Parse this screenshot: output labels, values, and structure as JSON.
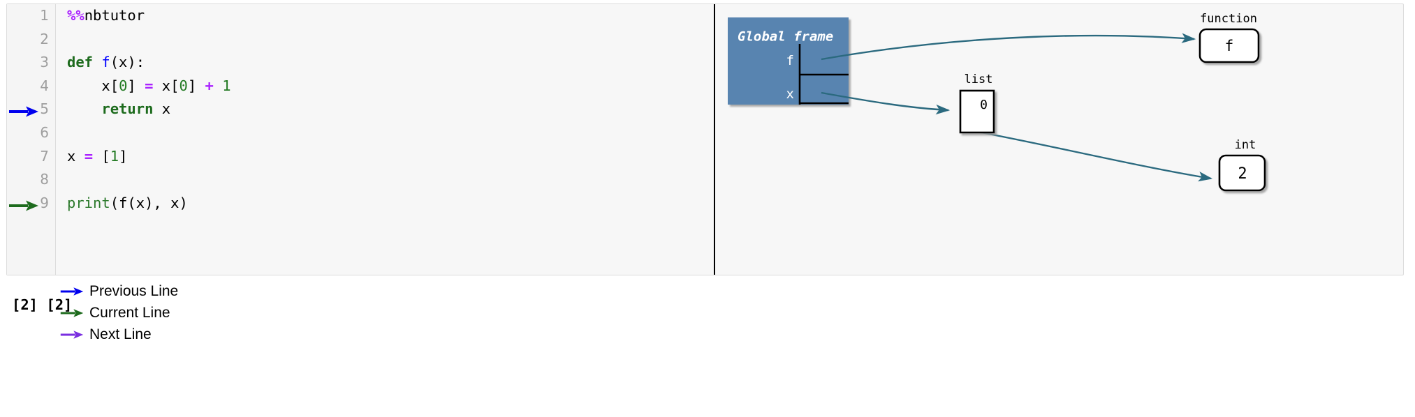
{
  "cell": {
    "magic": "%%nbtutor",
    "code_lines": [
      {
        "number": "1",
        "marker": "none",
        "tokens": [
          {
            "t": "%%",
            "c": "magic"
          },
          {
            "t": "nbtutor",
            "c": "plain"
          }
        ]
      },
      {
        "number": "2",
        "marker": "none",
        "tokens": []
      },
      {
        "number": "3",
        "marker": "none",
        "tokens": [
          {
            "t": "def",
            "c": "kw"
          },
          {
            "t": " ",
            "c": "plain"
          },
          {
            "t": "f",
            "c": "fname"
          },
          {
            "t": "(x):",
            "c": "plain"
          }
        ]
      },
      {
        "number": "4",
        "marker": "none",
        "tokens": [
          {
            "t": "    x[",
            "c": "plain"
          },
          {
            "t": "0",
            "c": "num"
          },
          {
            "t": "] ",
            "c": "plain"
          },
          {
            "t": "=",
            "c": "op"
          },
          {
            "t": " x[",
            "c": "plain"
          },
          {
            "t": "0",
            "c": "num"
          },
          {
            "t": "] ",
            "c": "plain"
          },
          {
            "t": "+",
            "c": "op"
          },
          {
            "t": " ",
            "c": "plain"
          },
          {
            "t": "1",
            "c": "num"
          }
        ]
      },
      {
        "number": "5",
        "marker": "previous",
        "tokens": [
          {
            "t": "    ",
            "c": "plain"
          },
          {
            "t": "return",
            "c": "kw"
          },
          {
            "t": " x",
            "c": "plain"
          }
        ]
      },
      {
        "number": "6",
        "marker": "none",
        "tokens": []
      },
      {
        "number": "7",
        "marker": "none",
        "tokens": [
          {
            "t": "x ",
            "c": "plain"
          },
          {
            "t": "=",
            "c": "op"
          },
          {
            "t": " [",
            "c": "plain"
          },
          {
            "t": "1",
            "c": "num"
          },
          {
            "t": "]",
            "c": "plain"
          }
        ]
      },
      {
        "number": "8",
        "marker": "none",
        "tokens": []
      },
      {
        "number": "9",
        "marker": "current",
        "tokens": [
          {
            "t": "print",
            "c": "builtin"
          },
          {
            "t": "(f(x), x)",
            "c": "plain"
          }
        ]
      }
    ]
  },
  "legend": {
    "items": [
      {
        "label": "Previous Line",
        "color": "#0000ee"
      },
      {
        "label": "Current Line",
        "color": "#1d6b1d"
      },
      {
        "label": "Next Line",
        "color": "#7a2ee0"
      }
    ]
  },
  "output": {
    "stdout": "[2] [2]"
  },
  "visualization": {
    "frame": {
      "title": "Global frame",
      "bg_color": "#5884b0",
      "title_color": "#ffffff",
      "variables": [
        {
          "name": "f",
          "points_to": "function-f"
        },
        {
          "name": "x",
          "points_to": "list-obj"
        }
      ]
    },
    "objects": [
      {
        "id": "function-f",
        "type_label": "function",
        "value": "f",
        "shape": "rounded"
      },
      {
        "id": "list-obj",
        "type_label": "list",
        "index": "0",
        "shape": "square"
      },
      {
        "id": "int-obj",
        "type_label": "int",
        "value": "2",
        "shape": "rounded"
      }
    ],
    "edges": [
      {
        "from": "f",
        "to": "function-f"
      },
      {
        "from": "x",
        "to": "list-obj"
      },
      {
        "from": "list-obj[0]",
        "to": "int-obj"
      }
    ],
    "arrow_color": "#2b6a7f",
    "object_border_color": "#000000",
    "object_fill": "#ffffff"
  }
}
